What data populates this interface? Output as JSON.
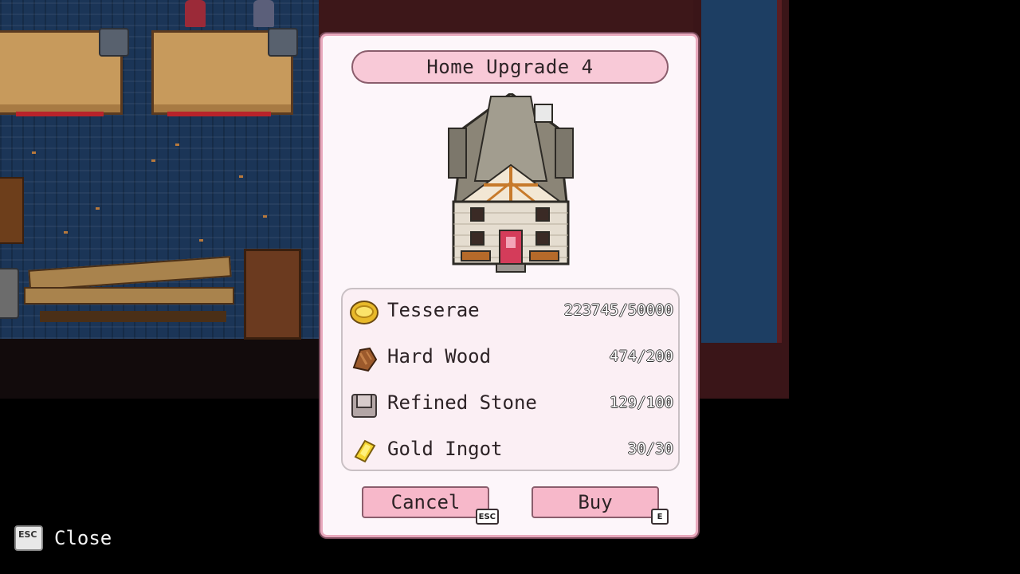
{
  "dialog": {
    "title": "Home Upgrade 4",
    "costs": [
      {
        "name": "Tesserae",
        "quantity": "223745/50000",
        "icon": "coin-icon"
      },
      {
        "name": "Hard Wood",
        "quantity": "474/200",
        "icon": "wood-log-icon"
      },
      {
        "name": "Refined Stone",
        "quantity": "129/100",
        "icon": "stone-block-icon"
      },
      {
        "name": "Gold Ingot",
        "quantity": "30/30",
        "icon": "gold-ingot-icon"
      }
    ],
    "cancel": {
      "label": "Cancel",
      "key": "ESC"
    },
    "buy": {
      "label": "Buy",
      "key": "E"
    }
  },
  "hint": {
    "key": "ESC",
    "label": "Close"
  },
  "colors": {
    "dialog_bg": "#fdf6fa",
    "pill_pink": "#f8c9d7",
    "button_pink": "#f7b8ca",
    "floor_blue": "#1b3557"
  }
}
